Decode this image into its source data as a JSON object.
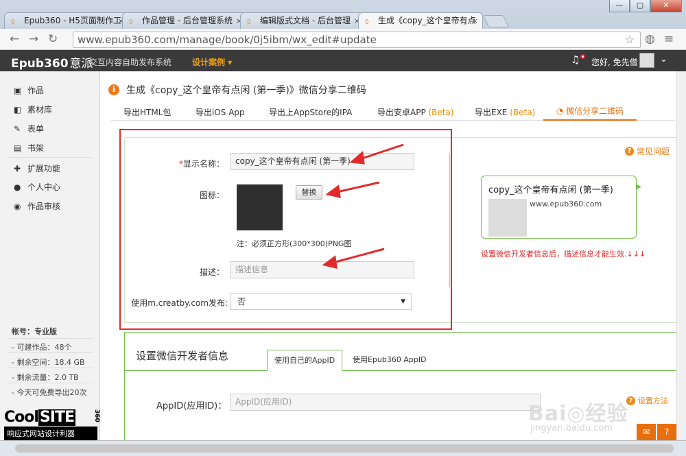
{
  "window": {
    "min": "—",
    "max": "▢",
    "close": "✕"
  },
  "tabs": [
    {
      "label": "Epub360 - H5页面制作工"
    },
    {
      "label": "作品管理 - 后台管理系统"
    },
    {
      "label": "编辑版式文档 - 后台管理"
    },
    {
      "label": "生成《copy_这个皇帝有点"
    }
  ],
  "address": {
    "url": "www.epub360.com/manage/book/0j5ibm/wx_edit#update"
  },
  "appbar": {
    "logo": "Epub360",
    "logo_cn": "意派",
    "system": "交互内容自助发布系统",
    "design": "设计案例 ▾",
    "user": "您好, 免先僧"
  },
  "sidebar": {
    "items": [
      {
        "icon": "monitor-icon",
        "glyph": "▣",
        "label": "作品"
      },
      {
        "icon": "box-icon",
        "glyph": "◧",
        "label": "素材库"
      },
      {
        "icon": "edit-icon",
        "glyph": "✎",
        "label": "表单"
      },
      {
        "icon": "book-icon",
        "glyph": "▤",
        "label": "书架"
      },
      {
        "icon": "puzzle-icon",
        "glyph": "✚",
        "label": "扩展功能"
      },
      {
        "icon": "user-icon",
        "glyph": "●",
        "label": "个人中心"
      },
      {
        "icon": "globe-icon",
        "glyph": "◉",
        "label": "作品审核"
      }
    ],
    "account": {
      "title": "帐号：专业版",
      "lines": [
        "- 可建作品：48个",
        "- 剩余空间：18.4 GB",
        "- 剩余流量：2.0 TB",
        "- 今天可免费导出20次"
      ]
    },
    "promo": {
      "brand_a": "Cool",
      "brand_b": "SITE",
      "brand_c": "360",
      "tagline": "响应式网站设计利器"
    }
  },
  "page": {
    "title": "生成《copy_这个皇帝有点闲 (第一季)》微信分享二维码",
    "tabs": [
      {
        "label": "导出HTML包"
      },
      {
        "label": "导出iOS App"
      },
      {
        "label": "导出上AppStore的IPA"
      },
      {
        "label": "导出安卓APP ",
        "beta": "(Beta)"
      },
      {
        "label": "导出EXE ",
        "beta": "(Beta)"
      },
      {
        "label": "微信分享二维码"
      }
    ]
  },
  "form": {
    "name_label": "显示名称：",
    "name_value": "copy_这个皇帝有点闲 (第一季)",
    "icon_label": "图标：",
    "replace_button": "替换",
    "icon_note": "注：必须正方形(300*300)PNG图",
    "desc_label": "描述：",
    "desc_placeholder": "描述信息",
    "publish_label": "使用m.creatby.com发布:",
    "publish_value": "否",
    "faq": "常见问题"
  },
  "preview": {
    "title": "copy_这个皇帝有点闲 (第一季)",
    "url": "www.epub360.com",
    "warning": "设置微信开发者信息后，描述信息才能生效.↓↓↓"
  },
  "developer": {
    "title": "设置微信开发者信息",
    "tab_own": "使用自己的AppID",
    "tab_epub": "使用Epub360 AppID",
    "appid_label": "AppID(应用ID)：",
    "appid_placeholder": "AppID(应用ID)",
    "howto": "设置方法"
  },
  "watermark": {
    "main": "Bai◎经验",
    "sub": "jingyan.baidu.com"
  },
  "fixed": {
    "help": "?",
    "feedback": "✉"
  },
  "colors": {
    "accent": "#e86f0e",
    "green": "#6fbe45",
    "red": "#e32a2a"
  }
}
